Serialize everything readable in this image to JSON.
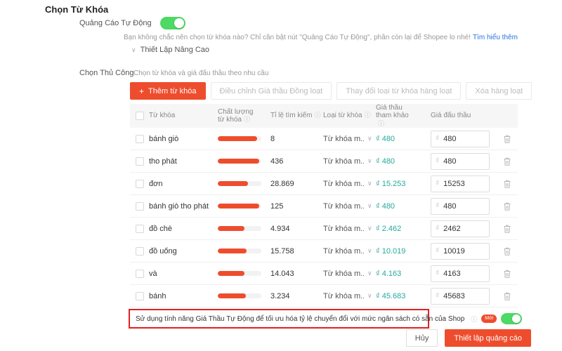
{
  "page": {
    "title": "Chọn Từ Khóa"
  },
  "auto_ads": {
    "label": "Quảng Cáo Tự Động",
    "toggle_on": true,
    "hint": "Bạn không chắc nên chọn từ khóa nào? Chỉ cần bật nút \"Quảng Cáo Tự Động\", phần còn lại để Shopee lo nhé!",
    "link": "Tìm hiểu thêm",
    "advanced_label": "Thiết Lập Nâng Cao"
  },
  "manual": {
    "label": "Chọn Thủ Công",
    "hint": "Chọn từ khóa và giá đấu thầu theo nhu cầu"
  },
  "toolbar": {
    "add_label": "Thêm từ khóa",
    "plus_icon": "+",
    "adjust_bid_label": "Điều chỉnh Giá thầu Đồng loạt",
    "change_type_label": "Thay đổi loại từ khóa hàng loạt",
    "delete_label": "Xóa hàng loạt"
  },
  "table": {
    "currency": "₫",
    "headers": [
      "Từ khóa",
      "Chất lượng từ khóa",
      "Tỉ lệ tìm kiếm",
      "Loại từ khóa",
      "Giá thầu tham khảo",
      "Giá đấu thầu"
    ],
    "rows": [
      {
        "keyword": "bánh giò",
        "quality_pct": 90,
        "search_volume": "8",
        "type": "Từ khóa m...",
        "ref_bid": "480",
        "bid": "480"
      },
      {
        "keyword": "tho phát",
        "quality_pct": 95,
        "search_volume": "436",
        "type": "Từ khóa m...",
        "ref_bid": "480",
        "bid": "480"
      },
      {
        "keyword": "đơn",
        "quality_pct": 70,
        "search_volume": "28.869",
        "type": "Từ khóa m...",
        "ref_bid": "15.253",
        "bid": "15253"
      },
      {
        "keyword": "bánh giò tho phát",
        "quality_pct": 95,
        "search_volume": "125",
        "type": "Từ khóa m...",
        "ref_bid": "480",
        "bid": "480"
      },
      {
        "keyword": "đồ chè",
        "quality_pct": 62,
        "search_volume": "4.934",
        "type": "Từ khóa m...",
        "ref_bid": "2.462",
        "bid": "2462"
      },
      {
        "keyword": "đồ uống",
        "quality_pct": 66,
        "search_volume": "15.758",
        "type": "Từ khóa m...",
        "ref_bid": "10.019",
        "bid": "10019"
      },
      {
        "keyword": "và",
        "quality_pct": 62,
        "search_volume": "14.043",
        "type": "Từ khóa m...",
        "ref_bid": "4.163",
        "bid": "4163"
      },
      {
        "keyword": "bánh",
        "quality_pct": 64,
        "search_volume": "3.234",
        "type": "Từ khóa m...",
        "ref_bid": "45.683",
        "bid": "45683"
      }
    ]
  },
  "callout": {
    "text": "Sử dụng tính năng Giá Thầu Tự Động để tối ưu hóa tỷ lệ chuyển đổi với mức ngân sách có sẵn của Shop",
    "badge": "Mới",
    "toggle_on": true
  },
  "footer": {
    "cancel_label": "Hủy",
    "submit_label": "Thiết lập quảng cáo"
  },
  "colors": {
    "accent_orange": "#ee4d2d",
    "teal_price": "#26aa99",
    "toggle_green": "#4cd964",
    "highlight_red": "#e02020",
    "link_blue": "#2673dd"
  }
}
